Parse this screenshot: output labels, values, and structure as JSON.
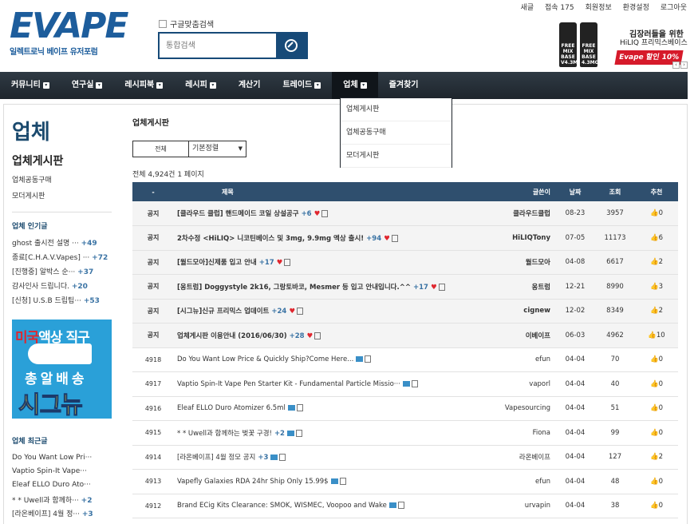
{
  "header": {
    "logo_text": "EVAPE",
    "logo_sub": "일렉트로닉 베이프 유저포럼",
    "google_check_label": "구글맞춤검색",
    "search_placeholder": "통합검색",
    "top_links": [
      "새글",
      "접속 175",
      "회원정보",
      "환경설정",
      "로그아웃"
    ]
  },
  "banner": {
    "bottle1": "FREE MIX BASE V4.3MG",
    "bottle2": "FREE MIX BASE 4.3MG",
    "line1": "김장러들을 위한",
    "line2": "HiLIQ 프리믹스베이스",
    "tag": "Evape 할인 10%"
  },
  "nav": {
    "items": [
      "커뮤니티",
      "연구실",
      "레시피북",
      "레시피",
      "계산기",
      "트레이드",
      "업체",
      "즐겨찾기"
    ],
    "dropdown": [
      "업체게시판",
      "업체공동구매",
      "모더게시판"
    ]
  },
  "sidebar": {
    "title": "업체",
    "current": "업체게시판",
    "subs": [
      "업체공동구매",
      "모더게시판"
    ],
    "popular_title": "업체 인기글",
    "popular": [
      {
        "text": "ghost 출시전 설명 ···",
        "count": "+49"
      },
      {
        "text": "종료[C.H.A.V.Vapes] ···",
        "count": "+72"
      },
      {
        "text": "[진행중] 알박스 순···",
        "count": "+37"
      },
      {
        "text": "감사인사 드립니다.",
        "count": "+20"
      },
      {
        "text": "[신청] U.S.B 드립팁···",
        "count": "+53"
      }
    ],
    "ad": {
      "l1a": "미국",
      "l1b": "액상 직구",
      "l2": "총알배송",
      "l3": "시그뉴"
    },
    "recent_title": "업체 최근글",
    "recent": [
      {
        "text": "Do You Want Low Pri···",
        "count": ""
      },
      {
        "text": "Vaptio Spin-It Vape···",
        "count": ""
      },
      {
        "text": "Eleaf ELLO Duro Ato···",
        "count": ""
      },
      {
        "text": "* * Uwell과 함께하···",
        "count": "+2"
      },
      {
        "text": "[라온베이프] 4월 정···",
        "count": "+3"
      }
    ]
  },
  "board": {
    "title": "업체게시판",
    "filter_all": "전체",
    "sort_label": "기본정렬",
    "total": "전체 4,924건 1 페이지",
    "columns": [
      "-",
      "제목",
      "글쓴이",
      "날짜",
      "조회",
      "추천"
    ],
    "rows": [
      {
        "num": "공지",
        "title": "[클라우드 클럽] 핸드메이드 코일 상설공구",
        "cnt": "+6",
        "author": "클라우드클럽",
        "date": "08-23",
        "views": "3957",
        "rec": "0",
        "notice": true
      },
      {
        "num": "공지",
        "title": "2차수정 <HiLIQ> 니코틴베이스 및 3mg, 9.9mg 액상 출시!",
        "cnt": "+94",
        "author": "HiLIQTony",
        "date": "07-05",
        "views": "11173",
        "rec": "6",
        "notice": true
      },
      {
        "num": "공지",
        "title": "[월드모아]신제품 입고 안내",
        "cnt": "+17",
        "author": "월드모아",
        "date": "04-08",
        "views": "6617",
        "rec": "2",
        "notice": true
      },
      {
        "num": "공지",
        "title": "[옹트럼] Doggystyle 2k16, 그랑토바코, Mesmer 등 입고 안내입니다.^^",
        "cnt": "+17",
        "author": "옹트럼",
        "date": "12-21",
        "views": "8990",
        "rec": "3",
        "notice": true
      },
      {
        "num": "공지",
        "title": "[시그뉴]신규 프리믹스 업데이트",
        "cnt": "+24",
        "author": "cignew",
        "date": "12-02",
        "views": "8349",
        "rec": "2",
        "notice": true
      },
      {
        "num": "공지",
        "title": "업체게시판 이용안내 (2016/06/30)",
        "cnt": "+28",
        "author": "이베이프",
        "date": "06-03",
        "views": "4962",
        "rec": "10",
        "notice": true
      },
      {
        "num": "4918",
        "title": "Do You Want Low Price & Quickly Ship?Come Here...",
        "cnt": "",
        "author": "efun",
        "date": "04-04",
        "views": "70",
        "rec": "0",
        "notice": false
      },
      {
        "num": "4917",
        "title": "Vaptio Spin-It Vape Pen Starter Kit - Fundamental Particle Missio···",
        "cnt": "",
        "author": "vaporl",
        "date": "04-04",
        "views": "40",
        "rec": "0",
        "notice": false
      },
      {
        "num": "4916",
        "title": "Eleaf ELLO Duro Atomizer 6.5ml",
        "cnt": "",
        "author": "Vapesourcing",
        "date": "04-04",
        "views": "51",
        "rec": "0",
        "notice": false
      },
      {
        "num": "4915",
        "title": "* * Uwell과 함께하는 벚꽃 구경!",
        "cnt": "+2",
        "author": "Fiona",
        "date": "04-04",
        "views": "99",
        "rec": "0",
        "notice": false
      },
      {
        "num": "4914",
        "title": "[라온베이프] 4월 정모 공지",
        "cnt": "+3",
        "author": "라온베이프",
        "date": "04-04",
        "views": "127",
        "rec": "2",
        "notice": false
      },
      {
        "num": "4913",
        "title": "Vapefly Galaxies RDA 24hr Ship Only 15.99$",
        "cnt": "",
        "author": "efun",
        "date": "04-04",
        "views": "48",
        "rec": "0",
        "notice": false
      },
      {
        "num": "4912",
        "title": "Brand ECig Kits Clearance: SMOK, WISMEC, Voopoo and Wake",
        "cnt": "",
        "author": "urvapin",
        "date": "04-04",
        "views": "38",
        "rec": "0",
        "notice": false
      }
    ]
  },
  "colors": {
    "brand": "#1d5d9c",
    "nav": "#2f3a44",
    "table_head": "#2f4f6e",
    "accent_red": "#d61a2a"
  }
}
